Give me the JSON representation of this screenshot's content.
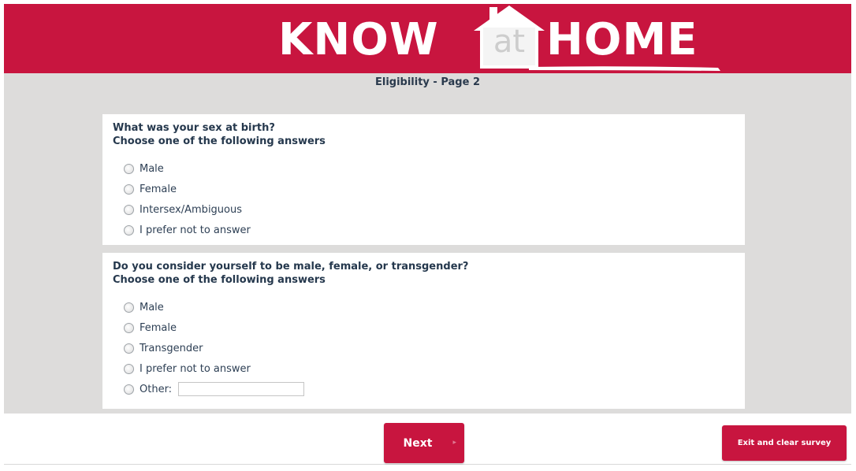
{
  "header": {
    "logo_left": "KNOW",
    "logo_at": "at",
    "logo_right": "HOME",
    "brand_color": "#c8153f"
  },
  "page": {
    "title": "Eligibility - Page 2"
  },
  "questions": [
    {
      "line1": "What was your sex at birth?",
      "line2": "Choose one of the following answers",
      "options": [
        "Male",
        "Female",
        "Intersex/Ambiguous",
        "I prefer not to answer"
      ]
    },
    {
      "line1": "Do you consider yourself to be male, female, or transgender?",
      "line2": "Choose one of the following answers",
      "options": [
        "Male",
        "Female",
        "Transgender",
        "I prefer not to answer",
        "Other:"
      ],
      "other_value": ""
    }
  ],
  "buttons": {
    "next": "Next",
    "next_icon": "chevron-right-icon",
    "exit": "Exit and clear survey"
  }
}
